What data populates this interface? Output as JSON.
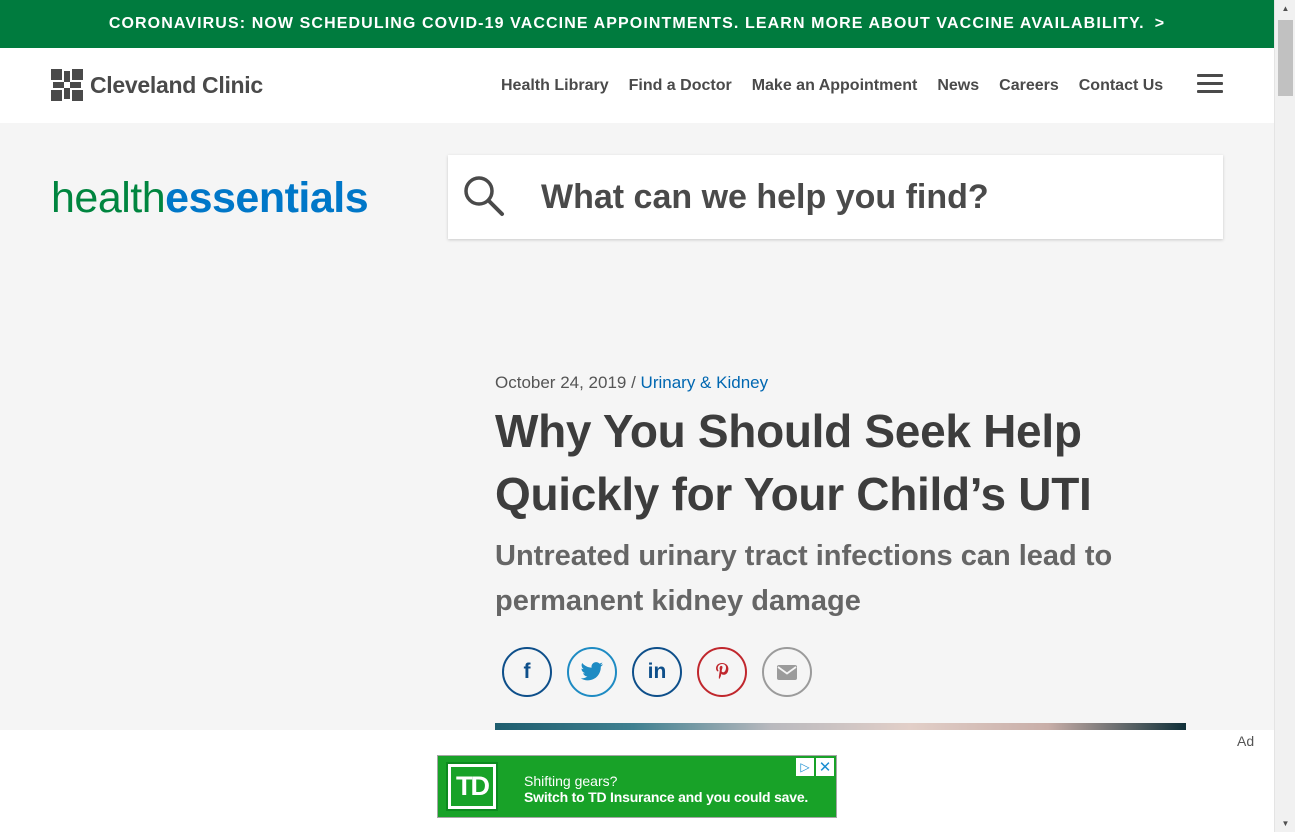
{
  "banner": {
    "text": "CORONAVIRUS: NOW SCHEDULING COVID-19 VACCINE APPOINTMENTS. LEARN MORE ABOUT VACCINE AVAILABILITY.",
    "chevron": ">"
  },
  "header": {
    "logo_text": "Cleveland Clinic",
    "nav": [
      "Health Library",
      "Find a Doctor",
      "Make an Appointment",
      "News",
      "Careers",
      "Contact Us"
    ]
  },
  "brand": {
    "part1": "health",
    "part2": "essentials"
  },
  "search": {
    "placeholder": "What can we help you find?"
  },
  "article": {
    "date": "October 24, 2019",
    "separator": " / ",
    "category": "Urinary & Kidney",
    "title": "Why You Should Seek Help Quickly for Your Child’s UTI",
    "subtitle": "Untreated urinary tract infections can lead to permanent kidney damage"
  },
  "share": {
    "facebook": "f",
    "linkedin": "in"
  },
  "ad": {
    "label": "Ad",
    "logo": "TD",
    "line1": "Shifting gears?",
    "line2": "Switch to TD Insurance and you could save."
  },
  "colors": {
    "banner_green": "#007b3e",
    "brand_green": "#00853f",
    "brand_blue": "#0077c8",
    "link_blue": "#0067b1"
  },
  "icons": [
    "cleveland-clinic-logo-icon",
    "hamburger-menu-icon",
    "search-icon",
    "facebook-icon",
    "twitter-icon",
    "linkedin-icon",
    "pinterest-icon",
    "email-icon",
    "ad-choices-icon",
    "close-icon"
  ]
}
